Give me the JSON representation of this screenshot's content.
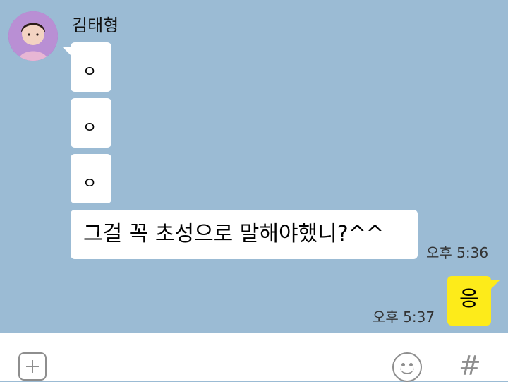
{
  "chat": {
    "sender_name": "김태형",
    "incoming_messages": [
      {
        "text": "ㅇ"
      },
      {
        "text": "ㅇ"
      },
      {
        "text": "ㅇ"
      },
      {
        "text": "그걸 꼭 초성으로 말해야했니?^^"
      }
    ],
    "incoming_time": "오후 5:36",
    "outgoing_message": {
      "text": "응"
    },
    "outgoing_time": "오후 5:37"
  },
  "input_bar": {
    "add_icon": "plus-square-icon",
    "emoji_icon": "smile-icon",
    "hash_label": "#"
  },
  "colors": {
    "chat_background": "#9bbbd4",
    "incoming_bubble": "#ffffff",
    "outgoing_bubble": "#fdeb1a",
    "icon_gray": "#8e8e8e"
  }
}
